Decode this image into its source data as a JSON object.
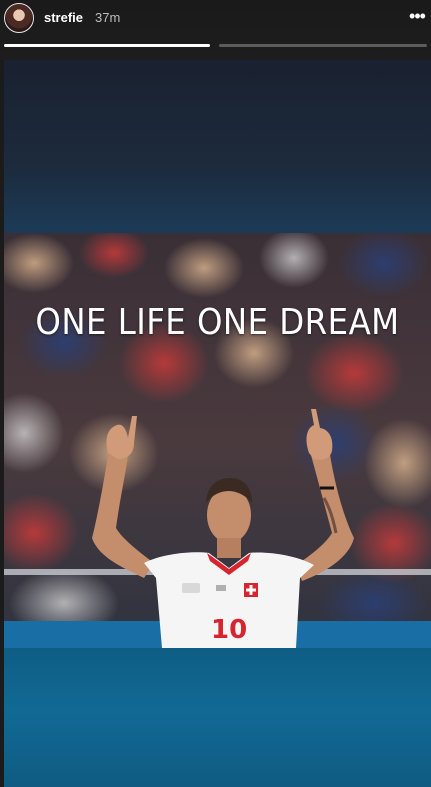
{
  "header": {
    "username": "strefie",
    "timestamp": "37m",
    "more_label": "•••",
    "avatar_icon": "profile-photo"
  },
  "progress": [
    {
      "state": "viewed",
      "fill": 1.0
    },
    {
      "state": "current",
      "fill": 0.0
    }
  ],
  "story": {
    "overlay_text": "ONE LIFE ONE DREAM",
    "jersey_number": "10",
    "colors": {
      "background_top": "#1a2130",
      "background_bottom": "#0f5b82",
      "jersey_red": "#d7242f",
      "jersey_white": "#f5f5f5"
    }
  }
}
